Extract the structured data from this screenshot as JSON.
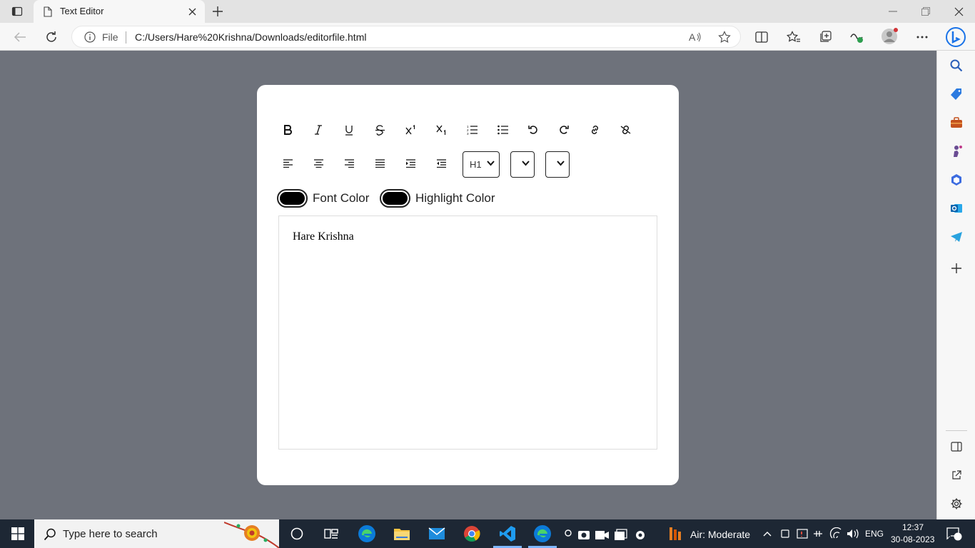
{
  "browser": {
    "tab_title": "Text Editor",
    "address": {
      "file_label": "File",
      "url": "C:/Users/Hare%20Krishna/Downloads/editorfile.html"
    },
    "icons": [
      "tab-actions-icon",
      "close-tab-icon",
      "new-tab-icon",
      "minimize-icon",
      "restore-icon",
      "close-window-icon",
      "back-icon",
      "refresh-icon",
      "info-icon",
      "read-aloud-icon",
      "favorite-star-icon",
      "split-screen-icon",
      "favorites-icon",
      "collections-icon",
      "performance-icon",
      "profile-icon",
      "more-icon",
      "bing-icon"
    ]
  },
  "sidebar": {
    "icons": [
      "search-icon",
      "shopping-icon",
      "tools-icon",
      "games-icon",
      "office-icon",
      "outlook-icon",
      "telegram-icon",
      "add-icon",
      "hide-sidebar-icon",
      "open-external-icon",
      "settings-icon"
    ]
  },
  "editor": {
    "toolbar_row1": [
      "bold-icon",
      "italic-icon",
      "underline-icon",
      "strikethrough-icon",
      "superscript-icon",
      "subscript-icon",
      "ordered-list-icon",
      "unordered-list-icon",
      "undo-icon",
      "redo-icon",
      "link-icon",
      "unlink-icon"
    ],
    "toolbar_row2": [
      "align-left-icon",
      "align-center-icon",
      "align-right-icon",
      "align-justify-icon",
      "indent-icon",
      "outdent-icon"
    ],
    "heading_select": {
      "value": "H1"
    },
    "font_size_select": {
      "value": ""
    },
    "font_name_select": {
      "value": ""
    },
    "font_color": {
      "label": "Font Color",
      "value": "#000000"
    },
    "highlight_color": {
      "label": "Highlight Color",
      "value": "#000000"
    },
    "content": "Hare Krishna"
  },
  "taskbar": {
    "search_placeholder": "Type here to search",
    "air_quality": "Air: Moderate",
    "language": "ENG",
    "time": "12:37",
    "date": "30-08-2023",
    "notification_count": "1"
  }
}
